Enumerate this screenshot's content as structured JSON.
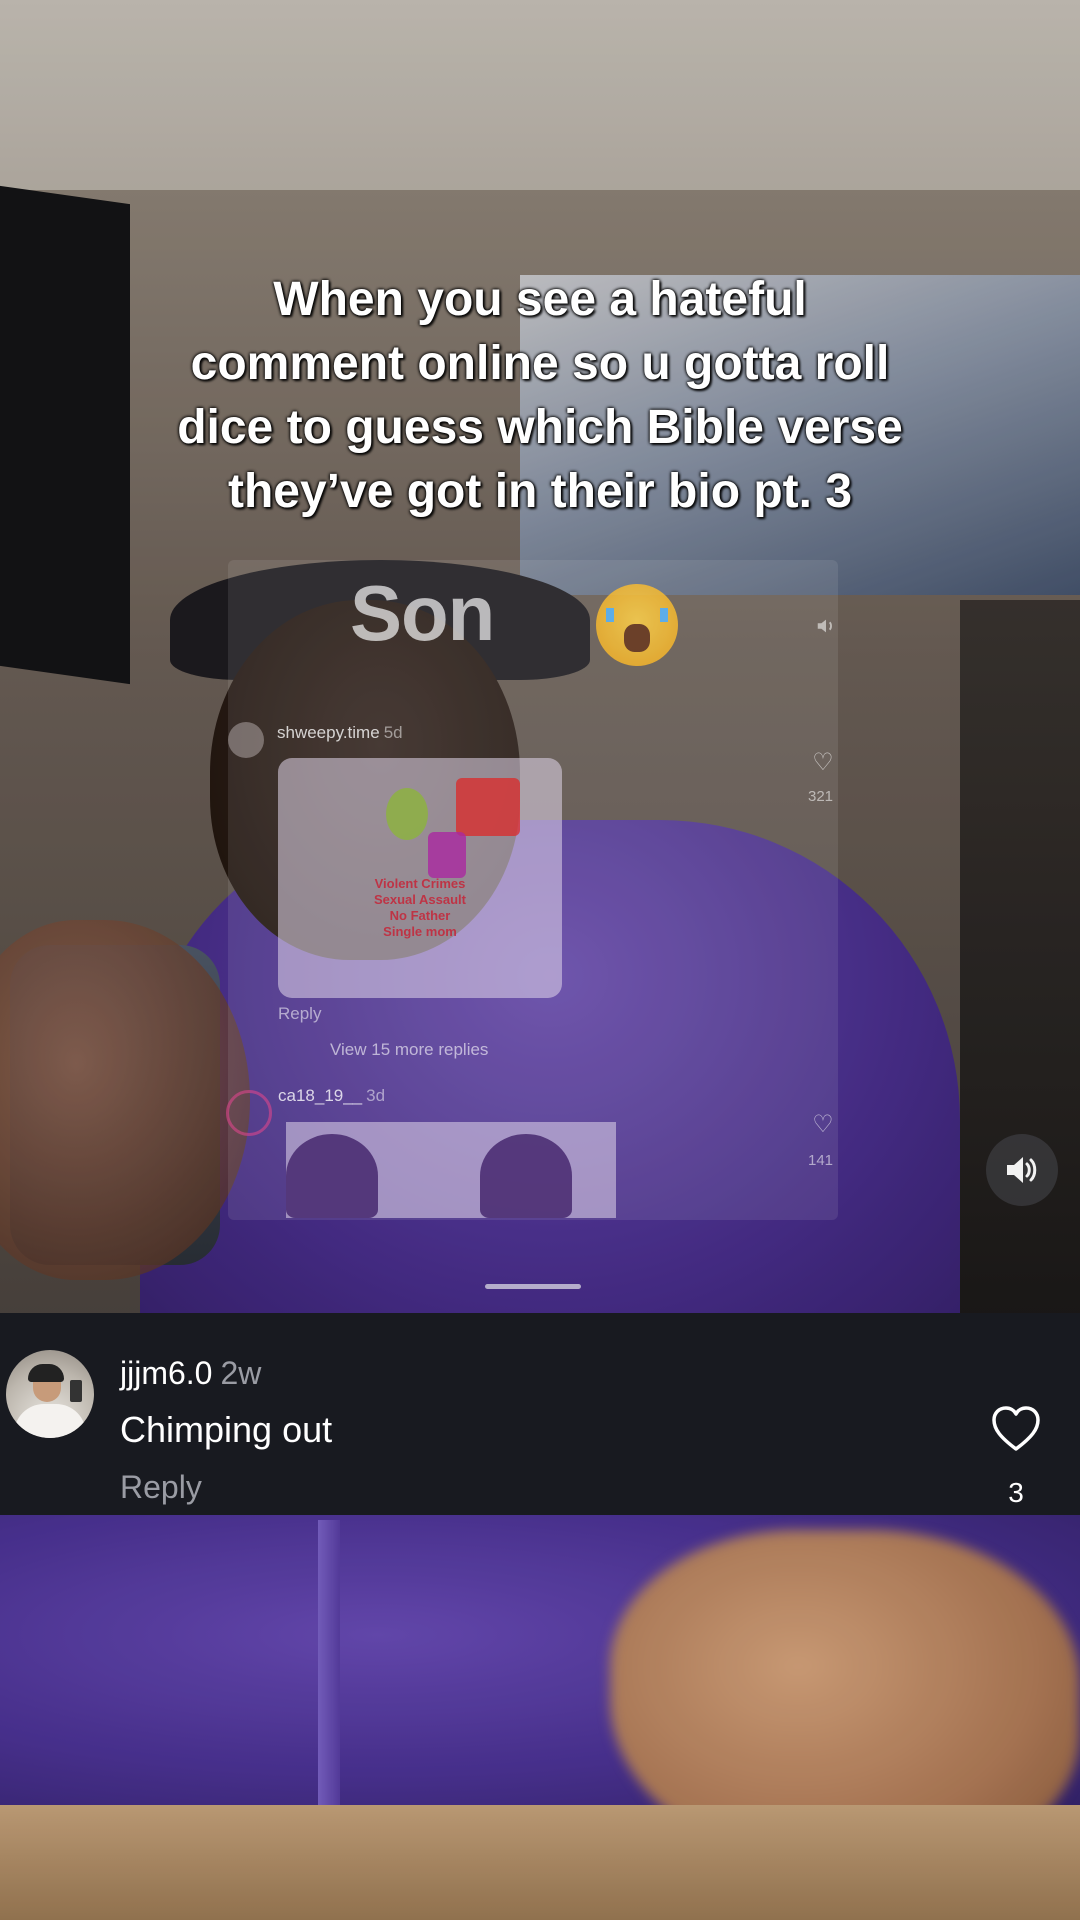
{
  "caption": {
    "lines": [
      "When you see a hateful",
      "comment online so u gotta roll",
      "dice to guess which Bible verse",
      "they’ve got in their bio pt. 3"
    ]
  },
  "overlay_screenshot": {
    "big_text": "Son",
    "emoji": "loudly-crying-face",
    "comments": [
      {
        "username": "shweepy.time",
        "time": "5d",
        "like_count": "321",
        "image_caption_lines": [
          "Violent Crimes",
          "Sexual Assault",
          "No Father",
          "Single mom"
        ],
        "reply_label": "Reply",
        "view_more_label": "View 15 more replies"
      },
      {
        "username": "ca18_19__",
        "time": "3d",
        "like_count": "141"
      }
    ]
  },
  "sound_button": {
    "icon": "speaker-icon"
  },
  "comment": {
    "username": "jjjm6.0",
    "time": "2w",
    "text": "Chimping out",
    "reply_label": "Reply",
    "like_count": "3",
    "like_icon": "heart-outline-icon"
  },
  "colors": {
    "comment_bar_bg": "#181a20",
    "secondary_text": "#9a9ca4",
    "hoodie_purple": "#4a2f8e"
  }
}
